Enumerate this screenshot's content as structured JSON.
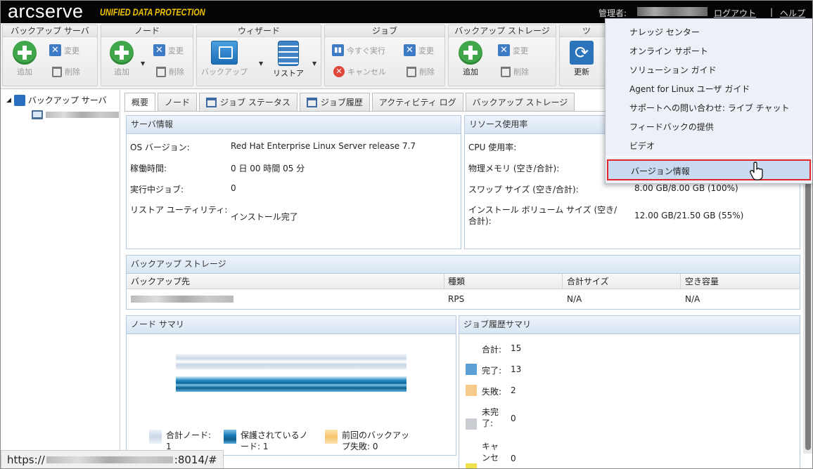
{
  "header": {
    "logo": "arcserve",
    "logo_sub": "UNIFIED DATA PROTECTION",
    "admin_label": "管理者:",
    "logout": "ログアウト",
    "separator": "|",
    "help": "ヘルプ"
  },
  "ribbon": {
    "groups": [
      {
        "title": "バックアップ サーバ",
        "add": "追加",
        "modify": "変更",
        "delete": "削除"
      },
      {
        "title": "ノード",
        "add": "追加",
        "modify": "変更",
        "delete": "削除"
      },
      {
        "title": "ウィザード",
        "backup": "バックアップ",
        "restore": "リストア"
      },
      {
        "title": "ジョブ",
        "run_now": "今すぐ実行",
        "modify": "変更",
        "cancel": "キャンセル",
        "delete": "削除"
      },
      {
        "title": "バックアップ ストレージ",
        "add": "追加",
        "modify": "変更",
        "delete": "削除"
      },
      {
        "title": "ツ",
        "refresh": "更新"
      }
    ]
  },
  "tree": {
    "root": "バックアップ サーバ"
  },
  "tabs": [
    "概要",
    "ノード",
    "ジョブ ステータス",
    "ジョブ履歴",
    "アクティビティ ログ",
    "バックアップ ストレージ"
  ],
  "server_info": {
    "title": "サーバ情報",
    "rows": [
      {
        "label": "OS バージョン:",
        "value": "Red Hat Enterprise Linux Server release 7.7"
      },
      {
        "label": "稼働時間:",
        "value": "0 日 00 時間 05 分"
      },
      {
        "label": "実行中ジョブ:",
        "value": "0"
      },
      {
        "label": "リストア ユーティリティ:",
        "value": "インストール完了"
      }
    ]
  },
  "resource_usage": {
    "title": "リソース使用率",
    "rows": [
      {
        "label": "CPU 使用率:",
        "value": ""
      },
      {
        "label": "物理メモリ (空き/合計):",
        "value": ""
      },
      {
        "label": "スワップ サイズ (空き/合計):",
        "value": "8.00 GB/8.00 GB (100%)"
      },
      {
        "label": "インストール ボリューム サイズ (空き/合計):",
        "value": "12.00 GB/21.50 GB (55%)"
      }
    ]
  },
  "backup_storage": {
    "title": "バックアップ ストレージ",
    "columns": [
      "バックアップ先",
      "種類",
      "合計サイズ",
      "空き容量"
    ],
    "rows": [
      {
        "type": "RPS",
        "total": "N/A",
        "free": "N/A"
      }
    ]
  },
  "node_summary": {
    "title": "ノード サマリ",
    "total_nodes": 1,
    "protected_nodes": 1,
    "last_backup_failed": 0,
    "legend": [
      {
        "label": "合計ノード: 1",
        "color": "#c9d7e6"
      },
      {
        "label": "保護されているノード: 1",
        "color": "#1a7db5"
      },
      {
        "label": "前回のバックアップ失敗: 0",
        "color": "#f6c46b"
      }
    ]
  },
  "job_summary": {
    "title": "ジョブ履歴サマリ",
    "items": [
      {
        "label": "合計:",
        "value": "15",
        "color": ""
      },
      {
        "label": "完了:",
        "value": "13",
        "color": "#5a9fd6"
      },
      {
        "label": "失敗:",
        "value": "2",
        "color": "#f7c98a"
      },
      {
        "label": "未完了:",
        "value": "0",
        "color": "#c9cdd1"
      },
      {
        "label": "キャンセ",
        "value": "0",
        "color": "#f0e24a"
      }
    ]
  },
  "help_menu": {
    "items": [
      "ナレッジ センター",
      "オンライン サポート",
      "ソリューション ガイド",
      "Agent for Linux ユーザ ガイド",
      "サポートへの問い合わせ: ライブ チャット",
      "フィードバックの提供",
      "ビデオ",
      "バージョン情報"
    ]
  },
  "status_bar": {
    "url_prefix": "https://",
    "url_suffix": ":8014/#"
  },
  "colors": {
    "topbar": "#050505",
    "logo_sub": "#f0c400",
    "panel_header": "#d7e5f3",
    "menu_highlight": "#c9daf1",
    "highlight_border": "#e02626"
  }
}
